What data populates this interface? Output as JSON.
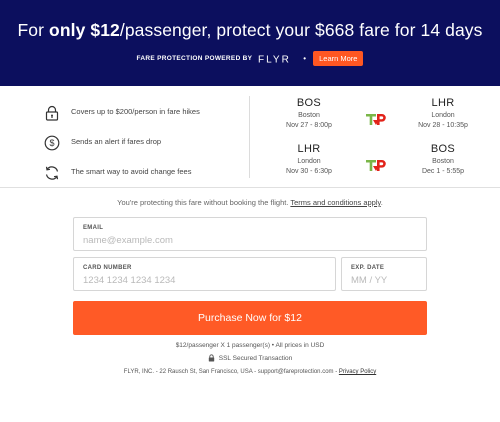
{
  "header": {
    "headline_pre": "For ",
    "headline_bold": "only $12",
    "headline_post": "/passenger, protect your $668 fare for 14 days",
    "powered_by": "FARE PROTECTION POWERED BY",
    "brand": "FLYR",
    "dot": "•",
    "learn_more": "Learn More"
  },
  "benefits": [
    {
      "icon": "lock-icon",
      "text": "Covers up to $200/person in fare hikes"
    },
    {
      "icon": "dollar-circle-icon",
      "text": "Sends an alert if fares drop"
    },
    {
      "icon": "refresh-icon",
      "text": "The smart way to avoid change fees"
    }
  ],
  "flights": [
    {
      "from": {
        "code": "BOS",
        "city": "Boston",
        "datetime": "Nov 27 - 8:00p"
      },
      "to": {
        "code": "LHR",
        "city": "London",
        "datetime": "Nov 28 - 10:35p"
      },
      "airline_logo": "tap-portugal-logo"
    },
    {
      "from": {
        "code": "LHR",
        "city": "London",
        "datetime": "Nov 30 - 6:30p"
      },
      "to": {
        "code": "BOS",
        "city": "Boston",
        "datetime": "Dec 1 - 5:55p"
      },
      "airline_logo": "tap-portugal-logo"
    }
  ],
  "notice": {
    "text": "You're protecting this fare without booking the flight. ",
    "terms_link": "Terms and conditions apply",
    "end": "."
  },
  "form": {
    "email": {
      "label": "EMAIL",
      "placeholder": "name@example.com",
      "value": ""
    },
    "card": {
      "label": "CARD NUMBER",
      "placeholder": "1234 1234 1234 1234",
      "value": ""
    },
    "exp": {
      "label": "EXP. DATE",
      "placeholder": "MM / YY",
      "value": ""
    }
  },
  "purchase_button": "Purchase Now for $12",
  "fine_print": {
    "price_note": "$12/passenger X 1 passenger(s) • All prices in USD",
    "ssl_note": "SSL Secured Transaction",
    "footer_text": "FLYR, INC. - 22 Rausch St, San Francisco, USA - support@fareprotection.com - ",
    "privacy_link": "Privacy Policy"
  },
  "colors": {
    "header_bg": "#0c0f5e",
    "accent": "#ff5a26",
    "tap_green": "#7ab648",
    "tap_red": "#e2231a"
  }
}
